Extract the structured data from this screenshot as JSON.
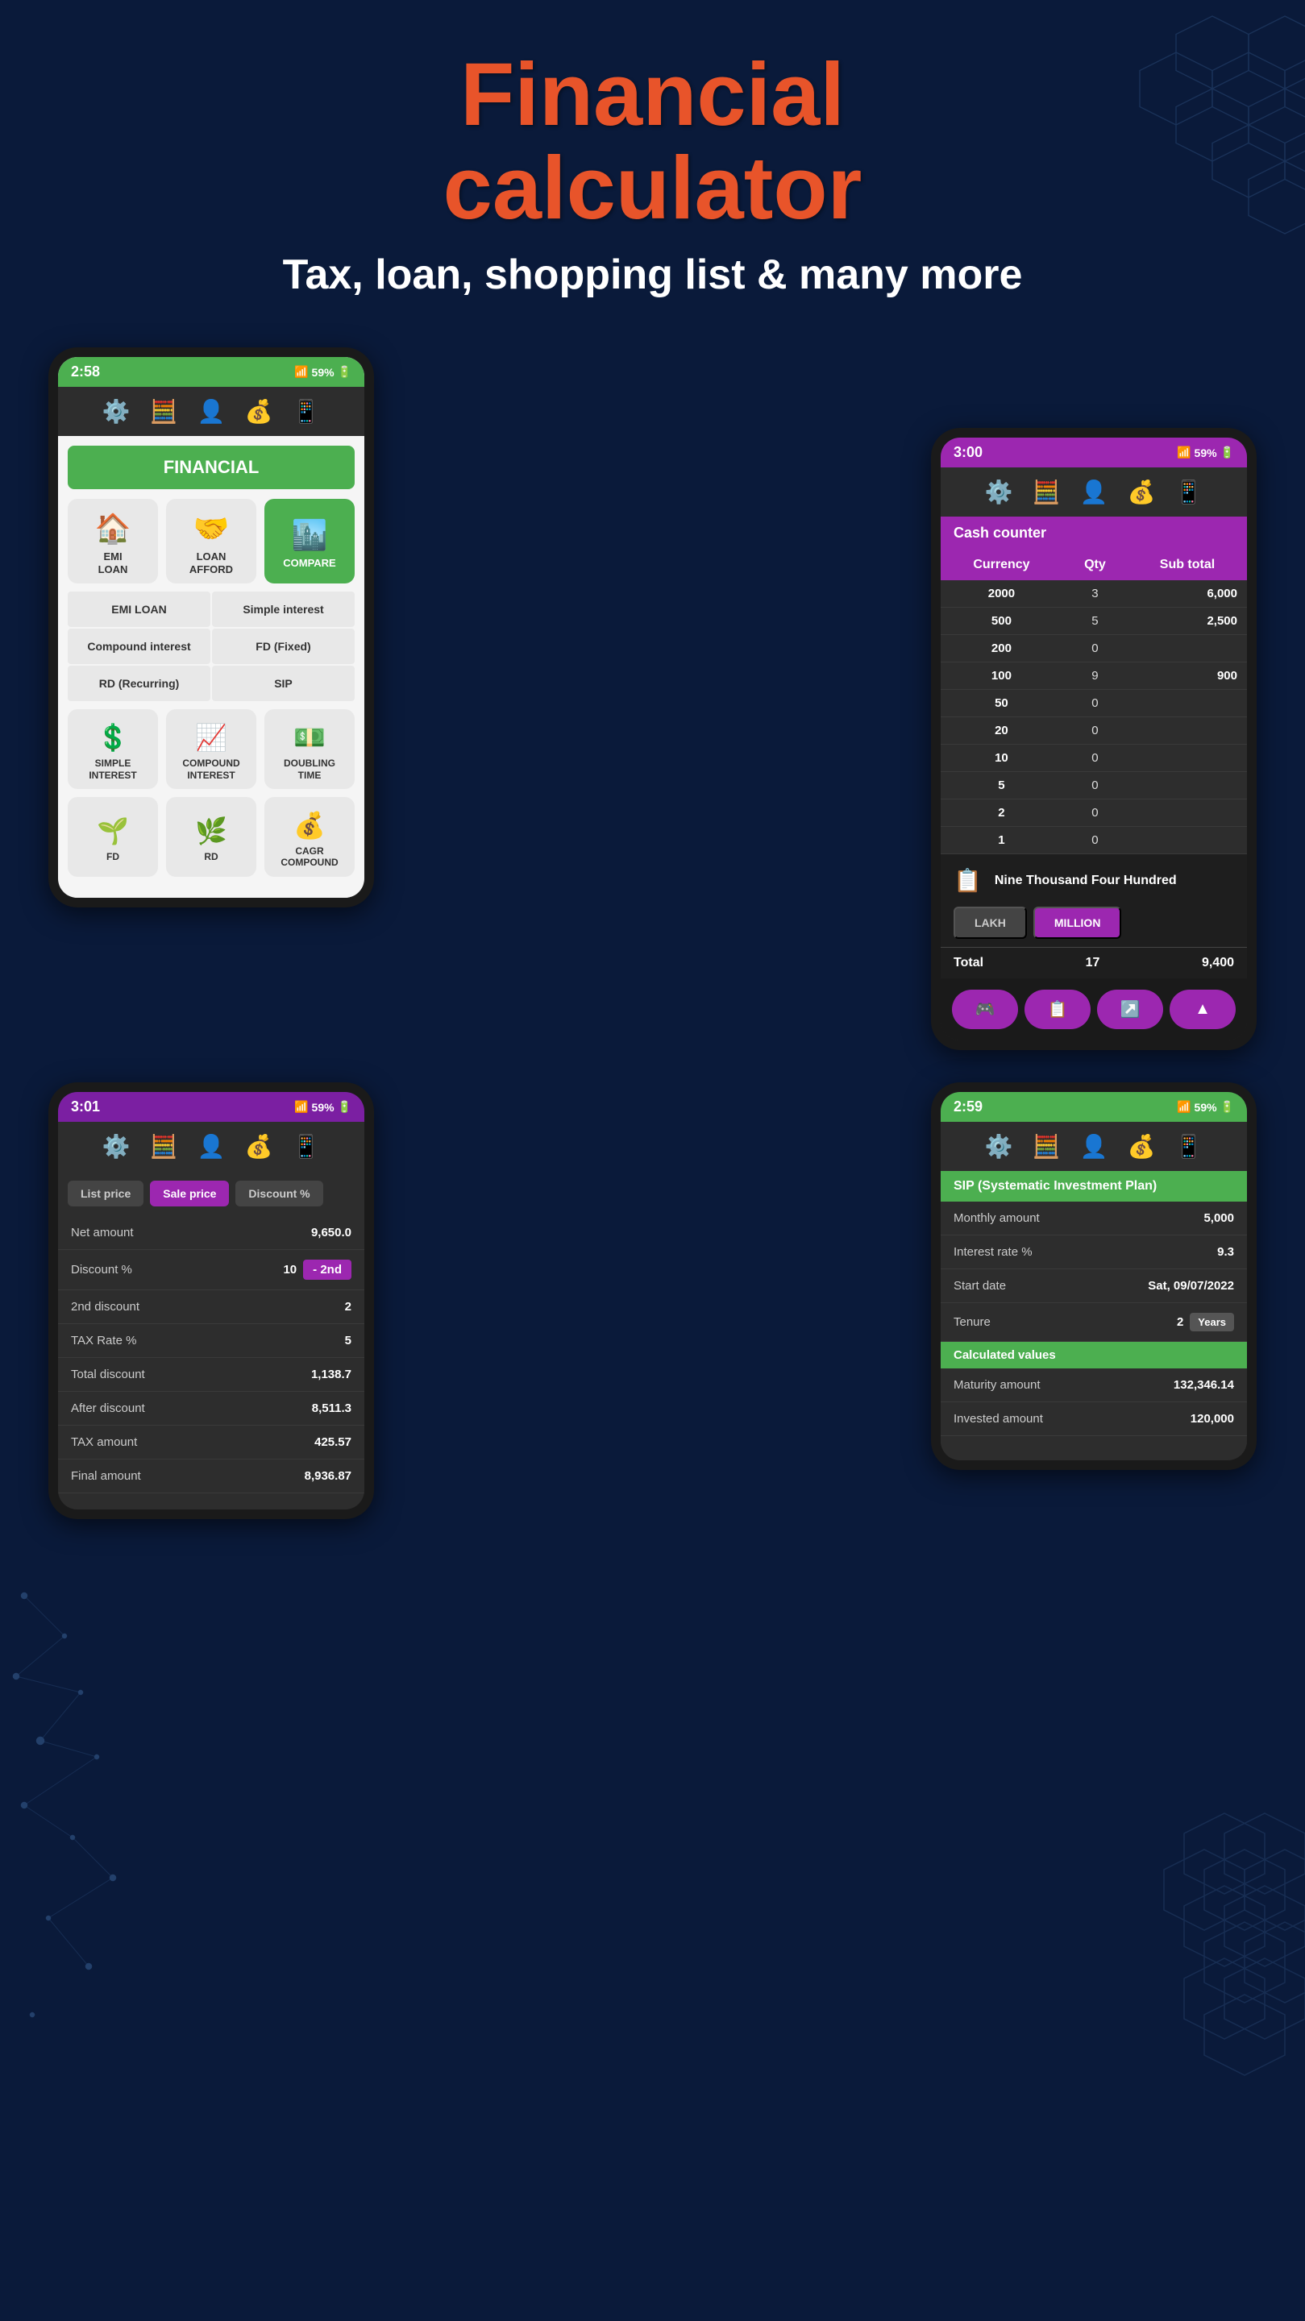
{
  "header": {
    "title_line1": "Financial",
    "title_line2": "calculator",
    "subtitle": "Tax, loan, shopping list & many more"
  },
  "screen1": {
    "status": {
      "time": "2:58",
      "battery": "59%",
      "signal": "📶"
    },
    "nav_icons": [
      "⚙️",
      "🧮",
      "👤",
      "💰",
      "📱"
    ],
    "financial_label": "FINANCIAL",
    "grid_items": [
      {
        "label": "EMI\nLOAN",
        "icon": "🏠",
        "active": false
      },
      {
        "label": "LOAN\nAFFORD",
        "icon": "🤝",
        "active": false
      },
      {
        "label": "COMPARE",
        "icon": "🏙️",
        "active": true
      }
    ],
    "menu_items": [
      "EMI LOAN",
      "Simple interest",
      "Compound interest",
      "FD (Fixed)",
      "RD (Recurring)",
      "SIP"
    ],
    "lower_items": [
      {
        "label": "SIMPLE\nINTEREST",
        "icon": "💲"
      },
      {
        "label": "COMPOUND\nINTEREST",
        "icon": "📈"
      },
      {
        "label": "DOUBLING\nTIME",
        "icon": "💵"
      },
      {
        "label": "FD",
        "icon": "🌱"
      },
      {
        "label": "RD",
        "icon": "🌿"
      },
      {
        "label": "CAGR\nCOMPOUND",
        "icon": "💰"
      }
    ]
  },
  "screen2": {
    "status": {
      "time": "3:00",
      "battery": "59%"
    },
    "nav_icons": [
      "⚙️",
      "🧮",
      "👤",
      "💰",
      "📱"
    ],
    "section_label": "Cash counter",
    "table_headers": [
      "Currency",
      "Qty",
      "Sub total"
    ],
    "rows": [
      {
        "currency": "2000",
        "qty": "3",
        "subtotal": "6,000"
      },
      {
        "currency": "500",
        "qty": "5",
        "subtotal": "2,500"
      },
      {
        "currency": "200",
        "qty": "0",
        "subtotal": ""
      },
      {
        "currency": "100",
        "qty": "9",
        "subtotal": "900"
      },
      {
        "currency": "50",
        "qty": "0",
        "subtotal": ""
      },
      {
        "currency": "20",
        "qty": "0",
        "subtotal": ""
      },
      {
        "currency": "10",
        "qty": "0",
        "subtotal": ""
      },
      {
        "currency": "5",
        "qty": "0",
        "subtotal": ""
      },
      {
        "currency": "2",
        "qty": "0",
        "subtotal": ""
      },
      {
        "currency": "1",
        "qty": "0",
        "subtotal": ""
      }
    ],
    "total_text": "Nine Thousand Four Hundred",
    "lakh_label": "LAKH",
    "million_label": "MILLION",
    "total_label": "Total",
    "total_count": "17",
    "total_amount": "9,400",
    "bottom_nav": [
      "🎮",
      "📋",
      "↗️",
      "▲"
    ]
  },
  "screen3": {
    "status": {
      "time": "3:01",
      "battery": "59%"
    },
    "nav_icons": [
      "⚙️",
      "🧮",
      "👤",
      "💰",
      "📱"
    ],
    "tabs": [
      "List price",
      "Sale price",
      "Discount %"
    ],
    "active_tab": "Sale price",
    "rows": [
      {
        "label": "Net amount",
        "value": "9,650.0",
        "extra": ""
      },
      {
        "label": "Discount %",
        "value": "10",
        "extra": "- 2nd"
      },
      {
        "label": "2nd discount",
        "value": "2",
        "extra": ""
      },
      {
        "label": "TAX Rate %",
        "value": "5",
        "extra": ""
      },
      {
        "label": "Total discount",
        "value": "1,138.7",
        "extra": ""
      },
      {
        "label": "After discount",
        "value": "8,511.3",
        "extra": ""
      },
      {
        "label": "TAX amount",
        "value": "425.57",
        "extra": ""
      },
      {
        "label": "Final amount",
        "value": "8,936.87",
        "extra": ""
      }
    ]
  },
  "screen4": {
    "status": {
      "time": "2:59",
      "battery": "59%"
    },
    "nav_icons": [
      "⚙️",
      "🧮",
      "👤",
      "💰",
      "📱"
    ],
    "sip_header": "SIP (Systematic Investment Plan)",
    "rows": [
      {
        "label": "Monthly amount",
        "value": "5,000",
        "unit": ""
      },
      {
        "label": "Interest rate %",
        "value": "9.3",
        "unit": ""
      },
      {
        "label": "Start date",
        "value": "Sat, 09/07/2022",
        "unit": ""
      },
      {
        "label": "Tenure",
        "value": "2",
        "unit": "Years"
      }
    ],
    "calc_values_header": "Calculated values",
    "calc_rows": [
      {
        "label": "Maturity amount",
        "value": "132,346.14"
      },
      {
        "label": "Invested amount",
        "value": "120,000"
      }
    ]
  },
  "colors": {
    "primary_orange": "#e8542a",
    "primary_green": "#4caf50",
    "primary_purple": "#9c27b0",
    "dark_bg": "#0a1a3a",
    "screen_dark": "#2d2d2d"
  }
}
